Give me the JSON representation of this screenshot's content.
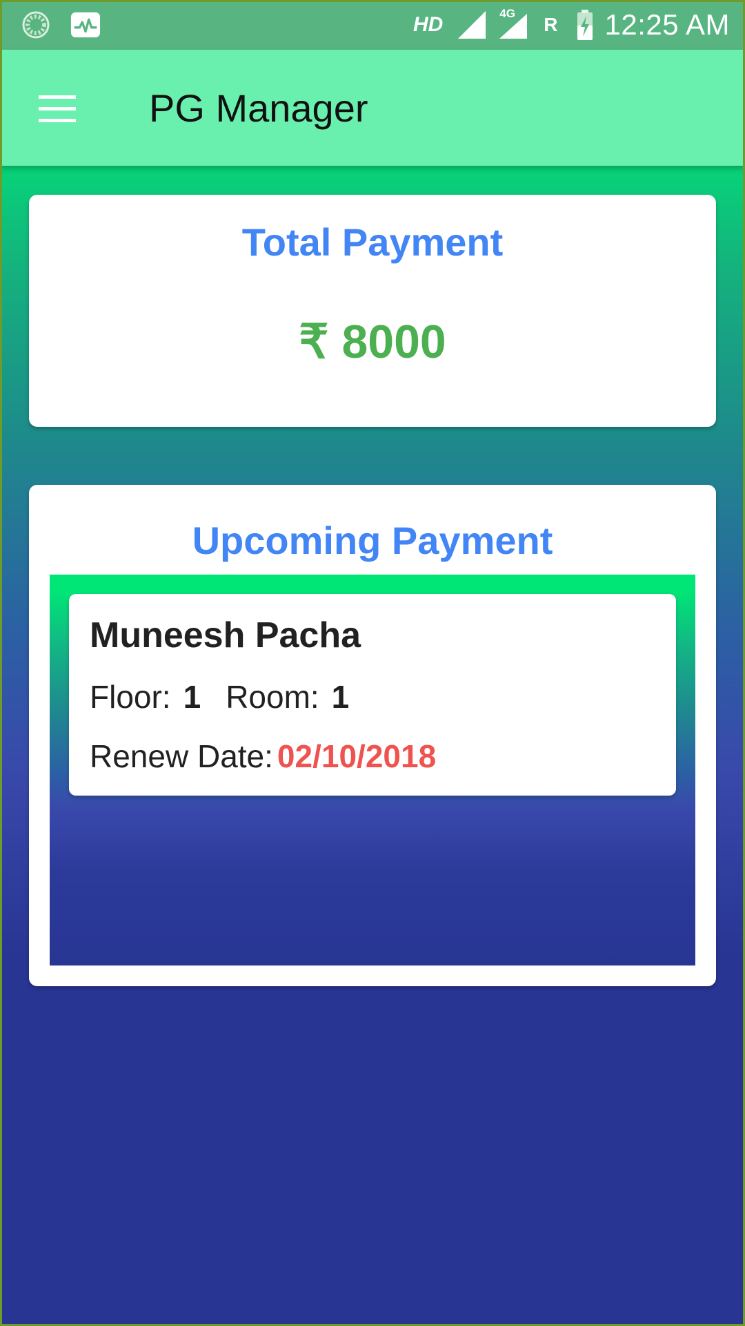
{
  "status_bar": {
    "left_icons": [
      "loading-circle-icon",
      "activity-monitor-icon"
    ],
    "hd": "HD",
    "network_type": "4G",
    "roaming": "R",
    "time": "12:25 AM"
  },
  "app_bar": {
    "title": "PG Manager",
    "menu_icon": "hamburger-menu-icon"
  },
  "total_payment": {
    "heading": "Total Payment",
    "amount": "₹ 8000"
  },
  "upcoming_payment": {
    "heading": "Upcoming Payment",
    "items": [
      {
        "name": "Muneesh Pacha",
        "floor_label": "Floor:",
        "floor": "1",
        "room_label": "Room:",
        "room": "1",
        "renew_label": "Renew Date:",
        "renew_date": "02/10/2018"
      }
    ]
  },
  "colors": {
    "app_bar": "#69f0ae",
    "status_bar": "#58b582",
    "heading_blue": "#4285f4",
    "amount_green": "#4caf50",
    "renew_red": "#ef5350",
    "bg_top": "#00e676",
    "bg_bottom": "#283593"
  }
}
